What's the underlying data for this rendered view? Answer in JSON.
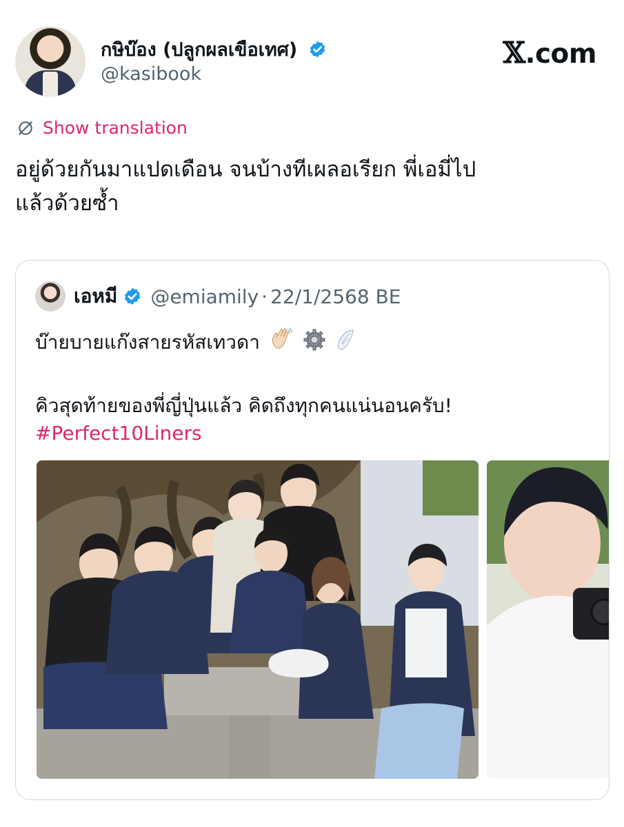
{
  "author": {
    "name": "กษิบ๊อง (ปลูกผลเขือเทศ)",
    "handle": "@kasibook",
    "verified": true
  },
  "brand": {
    "logo_x": "𝕏",
    "logo_domain": ".com"
  },
  "translation": {
    "label": "Show translation",
    "color": "#e0246f"
  },
  "tweet": {
    "lines": [
      "อยู่ด้วยกันมาแปดเดือน จนบ้างทีเผลอเรียก พี่เอมี่ไป",
      "แล้วด้วยซ้ำ"
    ]
  },
  "quote": {
    "name": "เอหมี",
    "handle": "@emiamily",
    "separator": "·",
    "date": "22/1/2568 BE",
    "verified": true,
    "line1": "บ๊ายบายแก๊งสายรหัสเทวดา",
    "line1_emojis": [
      "waving-hand-icon",
      "gear-icon",
      "wing-icon"
    ],
    "line2": "คิวสุดท้ายของพี่ญี่ปุ่นแล้ว คิดถึงทุกคนแน่นอนครับ!",
    "hashtag": "#Perfect10Liners",
    "media": [
      "group-photo",
      "photographer-photo"
    ]
  },
  "colors": {
    "accent": "#e0246f",
    "verified_blue": "#1d9bf0",
    "secondary_text": "#536471",
    "border": "#cfd9de"
  }
}
